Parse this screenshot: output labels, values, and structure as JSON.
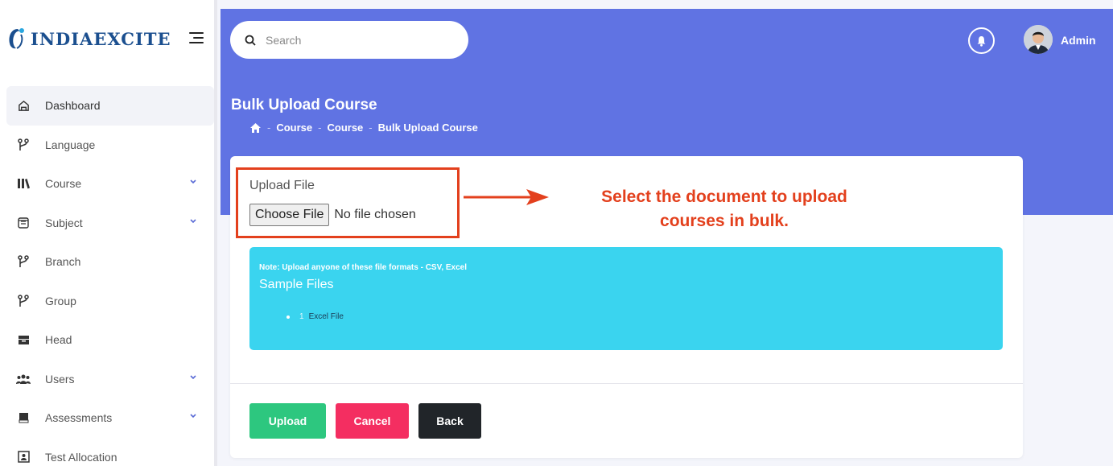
{
  "brand": {
    "name": "INDIAEXCITE"
  },
  "sidebar": {
    "items": [
      {
        "label": "Dashboard",
        "icon": "dashboard-icon",
        "has_submenu": false
      },
      {
        "label": "Language",
        "icon": "branch-icon",
        "has_submenu": false
      },
      {
        "label": "Course",
        "icon": "books-icon",
        "has_submenu": true
      },
      {
        "label": "Subject",
        "icon": "subject-icon",
        "has_submenu": true
      },
      {
        "label": "Branch",
        "icon": "branch-icon",
        "has_submenu": false
      },
      {
        "label": "Group",
        "icon": "branch-icon",
        "has_submenu": false
      },
      {
        "label": "Head",
        "icon": "archive-icon",
        "has_submenu": false
      },
      {
        "label": "Users",
        "icon": "users-icon",
        "has_submenu": true
      },
      {
        "label": "Assessments",
        "icon": "book-icon",
        "has_submenu": true
      },
      {
        "label": "Test Allocation",
        "icon": "allocation-icon",
        "has_submenu": false
      }
    ]
  },
  "header": {
    "search_placeholder": "Search",
    "user_name": "Admin"
  },
  "page": {
    "title": "Bulk Upload Course",
    "breadcrumb": [
      "Course",
      "Course",
      "Bulk Upload Course"
    ]
  },
  "form": {
    "upload_label": "Upload File",
    "choose_file_label": "Choose File",
    "no_file_text": "No file chosen",
    "note": "Note: Upload anyone of these file formats - CSV, Excel",
    "sample_heading": "Sample Files",
    "samples": [
      {
        "index": "1",
        "label": "Excel File"
      }
    ],
    "buttons": {
      "upload": "Upload",
      "cancel": "Cancel",
      "back": "Back"
    }
  },
  "annotation": {
    "line1": "Select the document to upload",
    "line2": "courses in bulk."
  },
  "colors": {
    "header_band": "#6073e3",
    "note_box": "#3ad4ef",
    "upload": "#2dc77f",
    "cancel": "#f42e61",
    "back": "#212529",
    "annotation": "#e3401d"
  }
}
